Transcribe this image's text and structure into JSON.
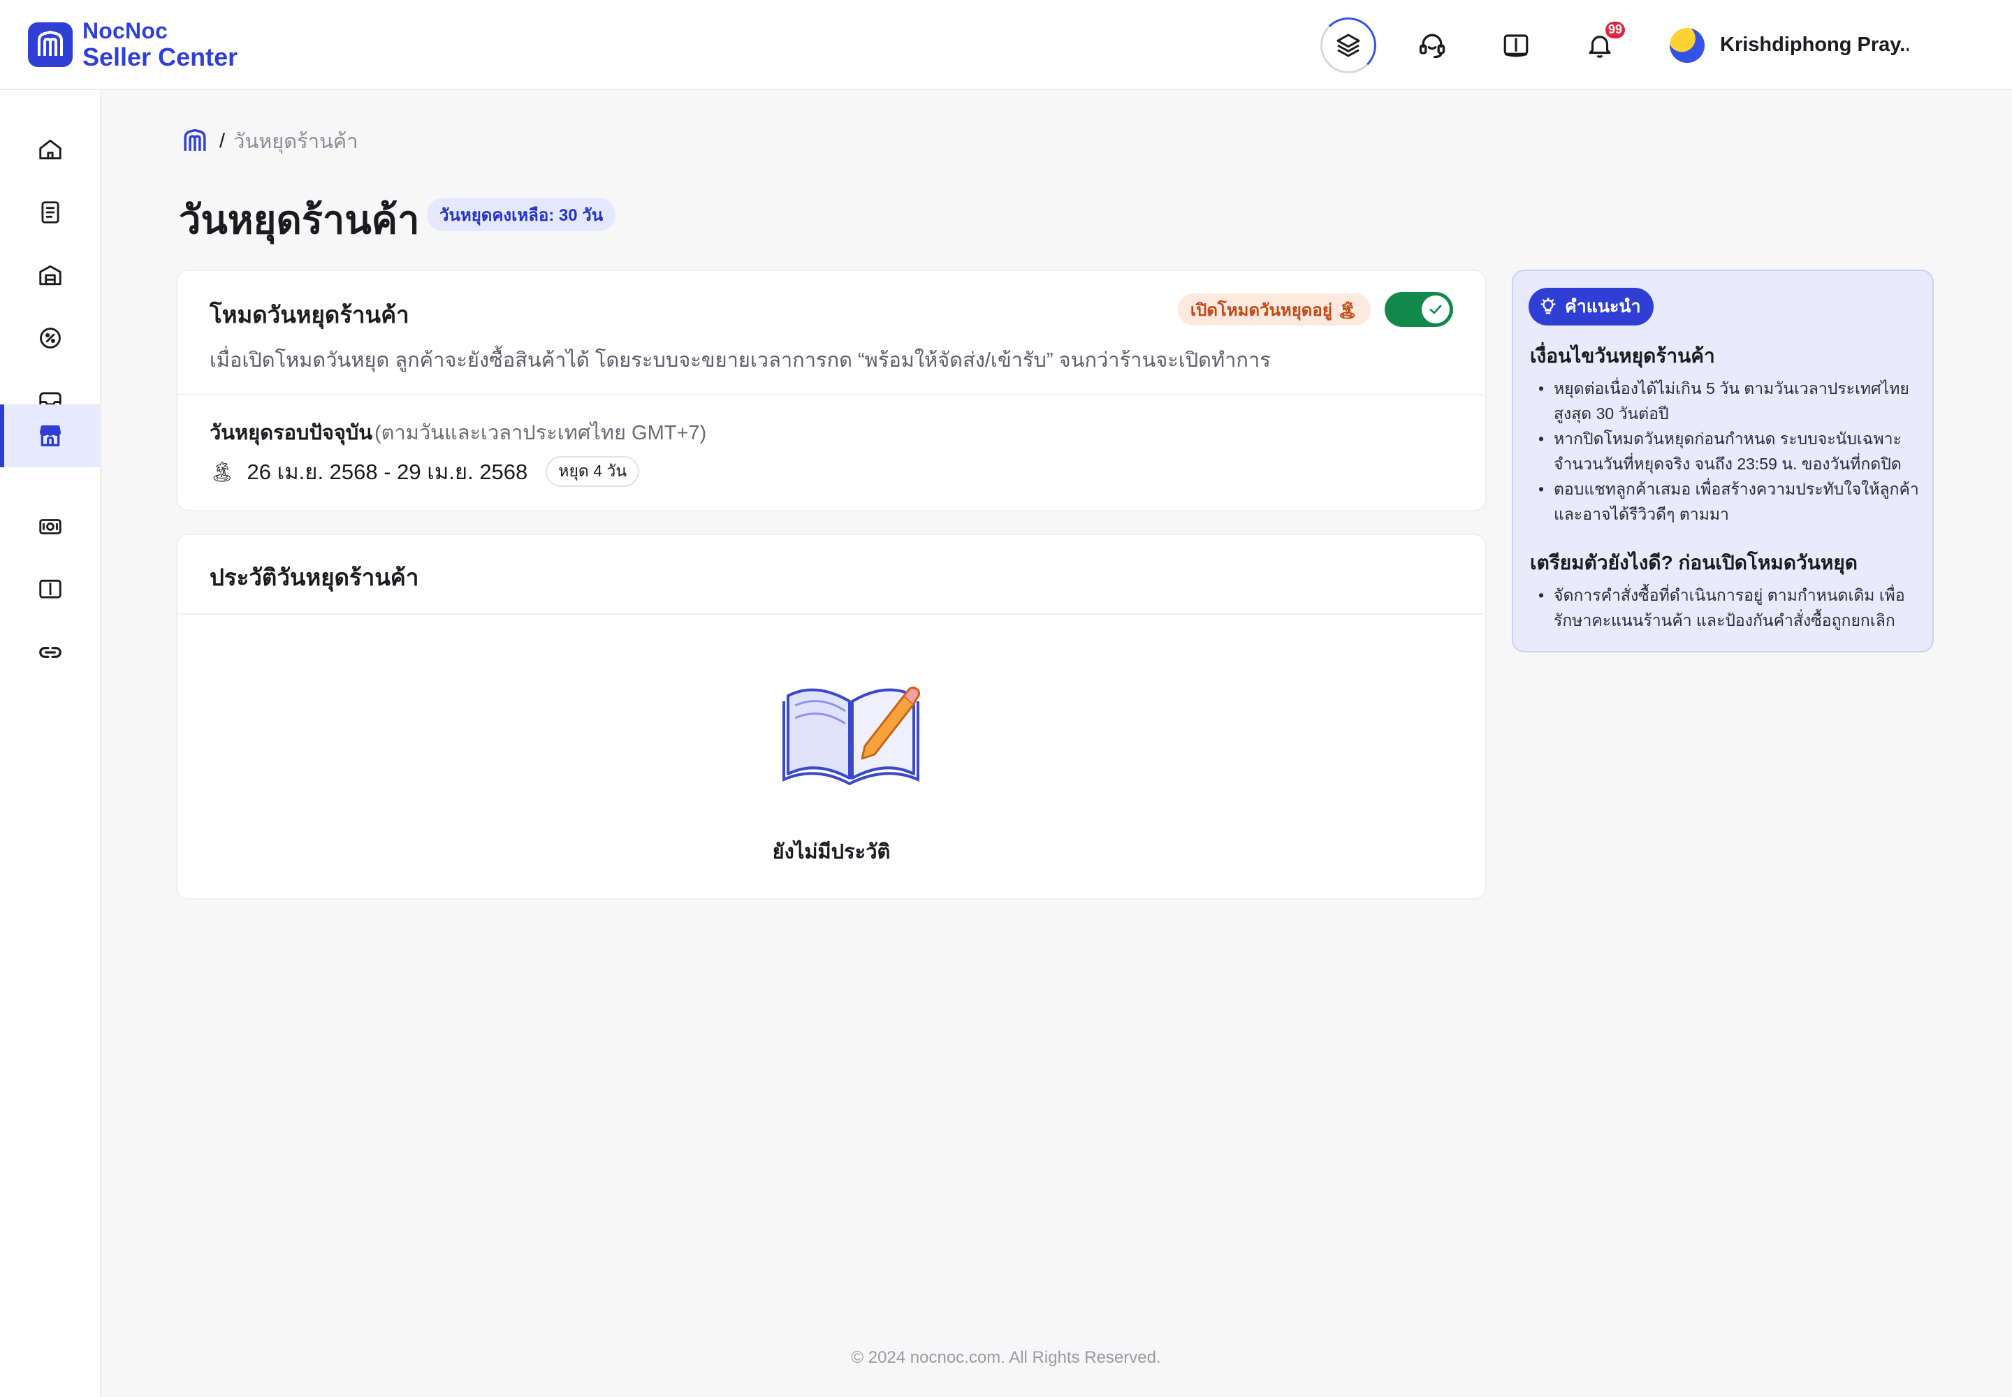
{
  "brand": {
    "line1": "NocNoc",
    "line2": "Seller Center"
  },
  "header": {
    "notification_count": "99",
    "user_name": "Krishdiphong Pray..."
  },
  "breadcrumb": {
    "separator": "/",
    "current": "วันหยุดร้านค้า"
  },
  "page": {
    "title": "วันหยุดร้านค้า",
    "remaining_badge": "วันหยุดคงเหลือ: 30 วัน"
  },
  "vacation_mode": {
    "title": "โหมดวันหยุดร้านค้า",
    "status_pill": "เปิดโหมดวันหยุดอยู่ 🏝",
    "toggle_on": true,
    "description": "เมื่อเปิดโหมดวันหยุด ลูกค้าจะยังซื้อสินค้าได้ โดยระบบจะขยายเวลาการกด “พร้อมให้จัดส่ง/เข้ารับ” จนกว่าร้านจะเปิดทำการ",
    "current_label": "วันหยุดรอบปัจจุบัน",
    "current_note": "(ตามวันและเวลาประเทศไทย GMT+7)",
    "date_range": "26 เม.ย. 2568 - 29 เม.ย. 2568",
    "days_chip": "หยุด 4 วัน"
  },
  "history": {
    "title": "ประวัติวันหยุดร้านค้า",
    "empty_text": "ยังไม่มีประวัติ"
  },
  "tips": {
    "pill_label": "คำแนะนำ",
    "section1_title": "เงื่อนไขวันหยุดร้านค้า",
    "section1_items": [
      "หยุดต่อเนื่องได้ไม่เกิน 5 วัน ตามวันเวลาประเทศไทย สูงสุด 30 วันต่อปี",
      "หากปิดโหมดวันหยุดก่อนกำหนด ระบบจะนับเฉพาะจำนวนวันที่หยุดจริง จนถึง 23:59 น. ของวันที่กดปิด",
      "ตอบแชทลูกค้าเสมอ เพื่อสร้างความประทับใจให้ลูกค้า และอาจได้รีวิวดีๆ ตามมา"
    ],
    "section2_title": "เตรียมตัวยังไงดี? ก่อนเปิดโหมดวันหยุด",
    "section2_items": [
      "จัดการคำสั่งซื้อที่ดำเนินการอยู่ ตามกำหนดเดิม เพื่อรักษาคะแนนร้านค้า และป้องกันคำสั่งซื้อถูกยกเลิก"
    ]
  },
  "footer": {
    "copyright": "© 2024 nocnoc.com. All Rights Reserved."
  },
  "colors": {
    "brand": "#2f3fd6",
    "toggle_on": "#12894a",
    "badge_red": "#e0263f",
    "vacation_pill_bg": "#fde9e0",
    "tips_bg": "#e9ebfc"
  },
  "icons": {
    "sidebar": [
      "home-icon",
      "orders-icon",
      "warehouse-icon",
      "promotion-icon",
      "inbox-icon",
      "store-icon",
      "finance-icon",
      "book-icon",
      "link-icon"
    ],
    "header": [
      "layers-icon",
      "support-icon",
      "book-icon",
      "bell-icon"
    ]
  }
}
